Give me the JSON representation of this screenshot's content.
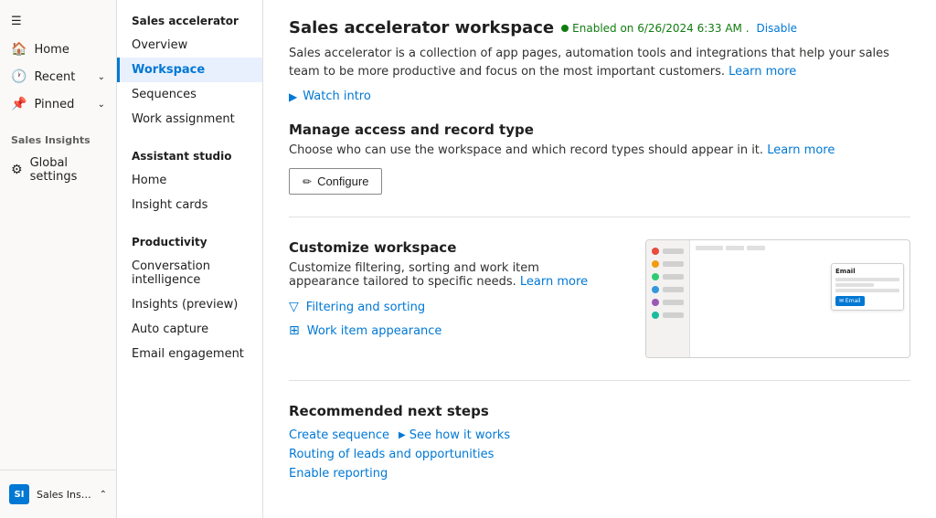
{
  "leftNav": {
    "hamburger": "☰",
    "items": [
      {
        "id": "home",
        "label": "Home",
        "icon": "🏠",
        "hasChevron": false
      },
      {
        "id": "recent",
        "label": "Recent",
        "icon": "🕐",
        "hasChevron": true
      },
      {
        "id": "pinned",
        "label": "Pinned",
        "icon": "📌",
        "hasChevron": true
      }
    ],
    "sectionLabel": "Sales Insights",
    "globalSettings": {
      "label": "Global settings",
      "icon": "⚙"
    },
    "bottom": {
      "badge": "SI",
      "label": "Sales Insights sett...",
      "chevron": "⌃"
    }
  },
  "midNav": {
    "sections": [
      {
        "title": "Sales accelerator",
        "items": [
          {
            "id": "overview",
            "label": "Overview",
            "active": false
          },
          {
            "id": "workspace",
            "label": "Workspace",
            "active": true
          },
          {
            "id": "sequences",
            "label": "Sequences",
            "active": false
          },
          {
            "id": "work-assignment",
            "label": "Work assignment",
            "active": false
          }
        ]
      },
      {
        "title": "Assistant studio",
        "items": [
          {
            "id": "assistant-home",
            "label": "Home",
            "active": false
          },
          {
            "id": "insight-cards",
            "label": "Insight cards",
            "active": false
          }
        ]
      },
      {
        "title": "Productivity",
        "items": [
          {
            "id": "conversation-intelligence",
            "label": "Conversation intelligence",
            "active": false
          },
          {
            "id": "insights-preview",
            "label": "Insights (preview)",
            "active": false
          },
          {
            "id": "auto-capture",
            "label": "Auto capture",
            "active": false
          },
          {
            "id": "email-engagement",
            "label": "Email engagement",
            "active": false
          }
        ]
      }
    ]
  },
  "main": {
    "title": "Sales accelerator workspace",
    "enabledText": "Enabled on 6/26/2024 6:33 AM .",
    "disableLabel": "Disable",
    "description": "Sales accelerator is a collection of app pages, automation tools and integrations that help your sales team to be more productive and focus on the most important customers.",
    "learnMoreDesc": "Learn more",
    "watchIntro": "Watch intro",
    "sections": {
      "manageAccess": {
        "title": "Manage access and record type",
        "description": "Choose who can use the workspace and which record types should appear in it.",
        "learnMore": "Learn more",
        "configureLabel": "Configure",
        "pencilIcon": "✏"
      },
      "customizeWorkspace": {
        "title": "Customize workspace",
        "description": "Customize filtering, sorting and work item appearance tailored to specific needs.",
        "learnMore": "Learn more",
        "filteringLabel": "Filtering and sorting",
        "filterIcon": "▽",
        "workItemLabel": "Work item appearance",
        "gridIcon": "⊞"
      },
      "recommendedNextSteps": {
        "title": "Recommended next steps",
        "links": [
          {
            "id": "create-sequence",
            "label": "Create sequence"
          },
          {
            "id": "see-how",
            "label": "See how it works",
            "isPlay": true
          },
          {
            "id": "routing",
            "label": "Routing of leads and opportunities"
          },
          {
            "id": "enable-reporting",
            "label": "Enable reporting"
          }
        ]
      }
    },
    "preview": {
      "dots": [
        {
          "color": "#e74c3c"
        },
        {
          "color": "#f39c12"
        },
        {
          "color": "#2ecc71"
        },
        {
          "color": "#3498db"
        },
        {
          "color": "#9b59b6"
        },
        {
          "color": "#1abc9c"
        }
      ],
      "emailCard": {
        "title": "Email",
        "btnLabel": "✉ Email"
      }
    }
  }
}
